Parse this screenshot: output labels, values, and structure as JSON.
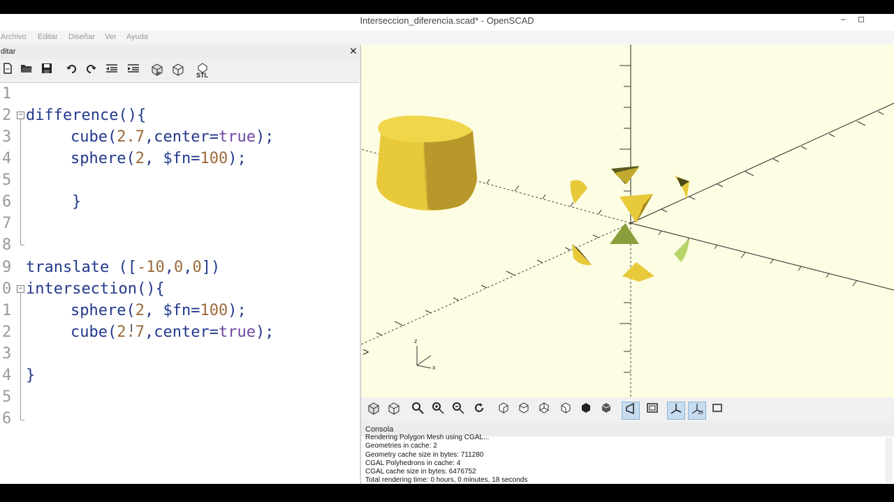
{
  "window": {
    "title": "Interseccion_diferencia.scad* - OpenSCAD",
    "minimize": "–",
    "maximize": "◻"
  },
  "menu": [
    "Archivo",
    "Editar",
    "Diseñar",
    "Ver",
    "Ayuda"
  ],
  "editor": {
    "panel_title": "ditar",
    "close": "✕",
    "toolbar_icons": [
      "new-file-icon",
      "open-file-icon",
      "save-icon",
      "undo-icon",
      "redo-icon",
      "unindent-icon",
      "indent-icon",
      "preview-icon",
      "render-icon",
      "export-stl-icon"
    ],
    "stl_label": "STL",
    "line_numbers": [
      "1",
      "2",
      "3",
      "4",
      "5",
      "6",
      "7",
      "8",
      "9",
      "0",
      "1",
      "2",
      "3",
      "4",
      "5",
      "6"
    ],
    "code": {
      "l2_fn": "difference",
      "l2_rest": "(){",
      "l3_fn": "cube(",
      "l3_num": "2.7",
      "l3_mid": ",center=",
      "l3_kw": "true",
      "l3_end": ");",
      "l4_fn": "sphere(",
      "l4_num": "2",
      "l4_mid": ", $fn=",
      "l4_num2": "100",
      "l4_end": ");",
      "l6": "}",
      "l9_fn": "translate ([",
      "l9_num": "-10",
      "l9_c1": ",",
      "l9_num2": "0",
      "l9_c2": ",",
      "l9_num3": "0",
      "l9_end": "])",
      "l10_fn": "intersection",
      "l10_rest": "(){",
      "l11_fn": "sphere(",
      "l11_num": "2",
      "l11_mid": ", $fn=",
      "l11_num2": "100",
      "l11_end": ");",
      "l12_fn": "cube(",
      "l12_num": "2.7",
      "l12_mid": ",center=",
      "l12_kw": "true",
      "l12_end": ");",
      "l14": "}"
    }
  },
  "viewport": {
    "background": "#fdfde3",
    "object_color": "#e8c93a",
    "axis_labels": {
      "z": "z",
      "x": "x"
    }
  },
  "view_toolbar_icons": [
    "preview-icon",
    "render-icon",
    "view-all-icon",
    "zoom-in-icon",
    "zoom-out-icon",
    "reset-view-icon",
    "view-right-icon",
    "view-top-icon",
    "view-bottom-icon",
    "view-left-icon",
    "view-front-icon",
    "view-back-icon",
    "perspective-icon",
    "orthogonal-icon",
    "show-axes-icon",
    "show-scale-icon",
    "show-edges-icon"
  ],
  "console": {
    "title": "Consola",
    "lines": [
      "Rendering Polygon Mesh using CGAL...",
      "Geometries in cache: 2",
      "Geometry cache size in bytes: 711280",
      "CGAL Polyhedrons in cache: 4",
      "CGAL cache size in bytes: 6476752",
      "Total rendering time: 0 hours, 0 minutes, 18 seconds"
    ]
  }
}
